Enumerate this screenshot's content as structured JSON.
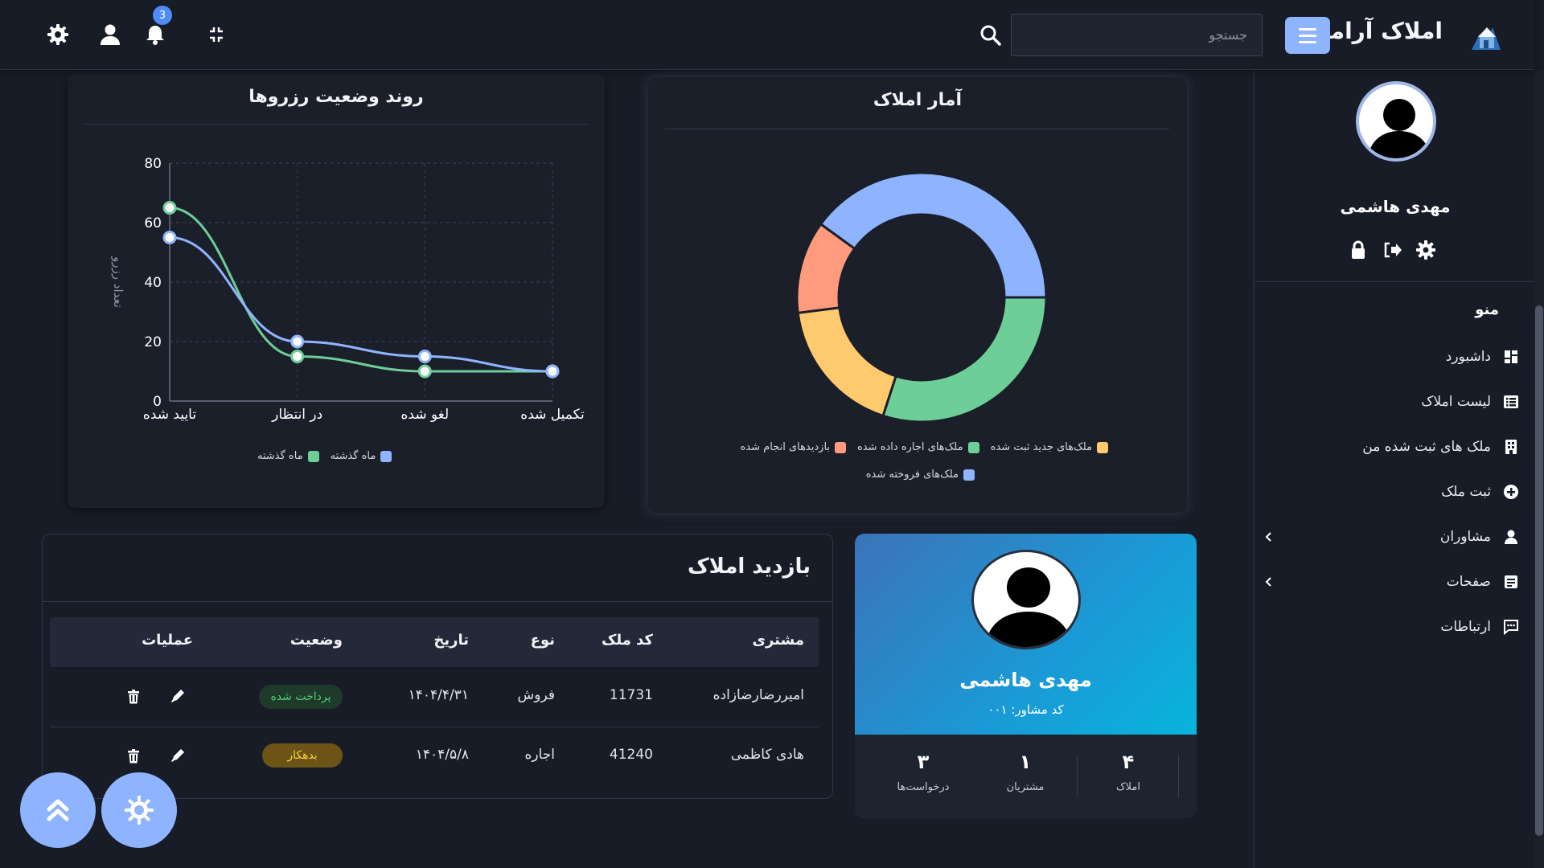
{
  "header": {
    "brand_name": "املاک آرامش",
    "search_placeholder": "جستجو",
    "notification_count": "3"
  },
  "sidebar": {
    "user_name": "مهدی هاشمی",
    "menu_title": "منو",
    "items": [
      {
        "label": "داشبورد",
        "icon": "dashboard-icon"
      },
      {
        "label": "لیست املاک",
        "icon": "list-icon"
      },
      {
        "label": "ملک های ثبت شده من",
        "icon": "building-icon"
      },
      {
        "label": "ثبت ملک",
        "icon": "plus-circle-icon"
      },
      {
        "label": "مشاوران",
        "icon": "users-icon"
      },
      {
        "label": "صفحات",
        "icon": "pages-icon"
      },
      {
        "label": "ارتباطات",
        "icon": "chat-icon"
      }
    ]
  },
  "property_stats": {
    "title": "آمار املاک",
    "legend": [
      "ملک‌های جدید ثبت شده",
      "ملک‌های اجاره داده شده",
      "بازدیدهای انجام شده",
      "ملک‌های فروخته شده"
    ]
  },
  "reservations": {
    "title": "روند وضعیت رزروها",
    "legend": [
      "ماه گذشته",
      "ماه گذشته"
    ]
  },
  "visits": {
    "title": "بازدید املاک",
    "columns": [
      "مشتری",
      "کد ملک",
      "نوع",
      "تاریخ",
      "وضعیت",
      "عملیات"
    ],
    "rows": [
      {
        "customer": "امیررضارضازاده",
        "code": "11731",
        "type": "فروش",
        "date": "۱۴۰۴/۴/۳۱",
        "status": "پرداخت شده"
      },
      {
        "customer": "هادی کاظمی",
        "code": "41240",
        "type": "اجاره",
        "date": "۱۴۰۴/۵/۸",
        "status": "بدهکار"
      }
    ]
  },
  "profile": {
    "name": "مهدی هاشمی",
    "code": "کد مشاور: ۰۰۱",
    "stats": [
      {
        "value": "۴",
        "label": "املاک"
      },
      {
        "value": "۱",
        "label": "مشتریان"
      },
      {
        "value": "۳",
        "label": "درخواست‌ها"
      }
    ]
  },
  "colors": {
    "accent": "#8fb4ff",
    "green": "#6dcf97",
    "blue": "#8fb4ff",
    "orange": "#ffc96e",
    "salmon": "#ff9a7d",
    "background": "#181c27"
  },
  "chart_data": [
    {
      "type": "pie",
      "title": "آمار املاک",
      "donut": true,
      "categories": [
        "ملک‌های فروخته شده",
        "بازدیدهای انجام شده",
        "ملک‌های جدید ثبت شده",
        "ملک‌های اجاره داده شده"
      ],
      "values": [
        40,
        12,
        18,
        30
      ],
      "colors": [
        "#8fb4ff",
        "#ff9a7d",
        "#ffc96e",
        "#6dcf97"
      ],
      "legend_position": "bottom"
    },
    {
      "type": "line",
      "title": "روند وضعیت رزروها",
      "categories": [
        "تایید شده",
        "در انتظار",
        "لغو شده",
        "تکمیل شده"
      ],
      "ylabel": "تعداد رزرو",
      "ylim": [
        0,
        80
      ],
      "yticks": [
        0,
        20,
        40,
        60,
        80
      ],
      "grid": true,
      "series": [
        {
          "name": "ماه گذشته",
          "values": [
            65,
            15,
            10,
            10
          ],
          "color": "#6dcf97"
        },
        {
          "name": "ماه گذشته",
          "values": [
            55,
            20,
            15,
            10
          ],
          "color": "#8fb4ff"
        }
      ],
      "legend_position": "bottom"
    }
  ]
}
